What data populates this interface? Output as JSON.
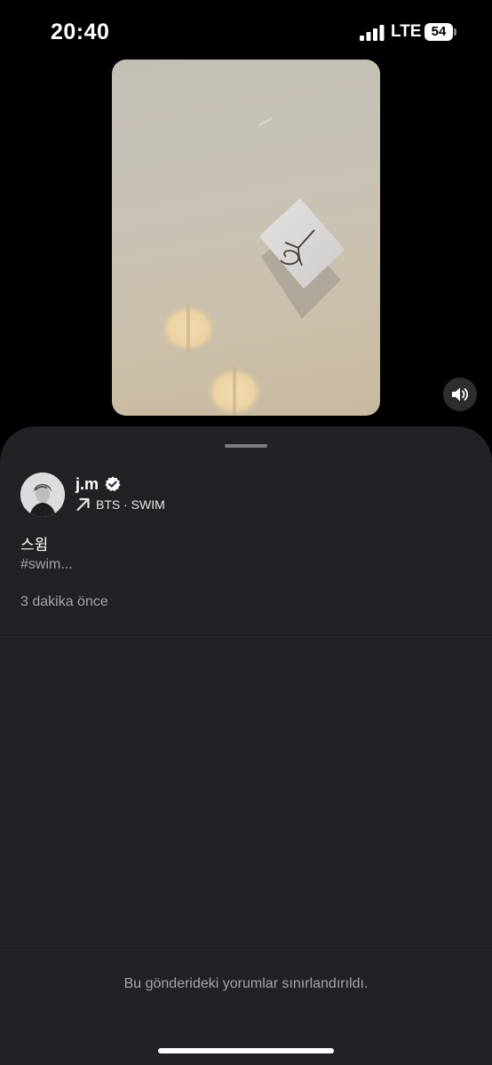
{
  "status_bar": {
    "time": "20:40",
    "network": "LTE",
    "battery": "54"
  },
  "video": {
    "note_text": "Y",
    "volume_icon": "speaker-wave-icon"
  },
  "post": {
    "username": "j.m",
    "verified_icon": "verified-badge-icon",
    "music_icon": "arrow-up-right-icon",
    "music": "BTS · SWIM",
    "caption": "스윔",
    "hashtags": "#swim...",
    "time_ago": "3 dakika önce"
  },
  "comments": {
    "notice": "Bu gönderideki yorumlar sınırlandırıldı."
  },
  "colors": {
    "background": "#000000",
    "sheet": "#212226",
    "secondary_text": "#a3a4a9"
  }
}
